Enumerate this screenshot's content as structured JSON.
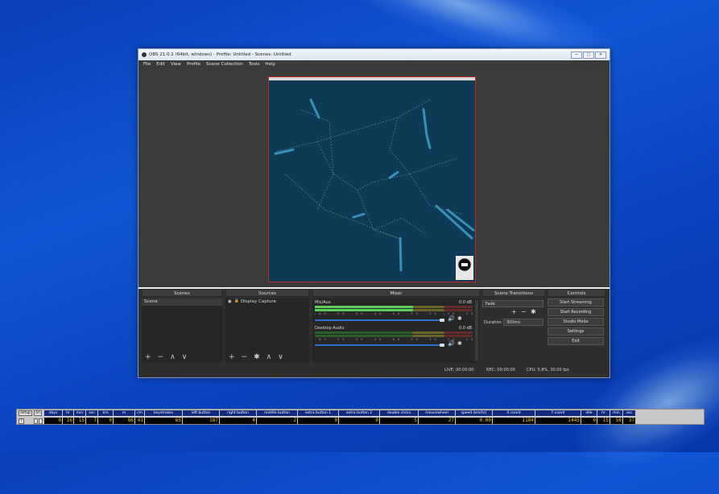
{
  "window": {
    "title": "OBS 21.0.1 (64bit, windows) - Profile: Untitled - Scenes: Untitled",
    "controls": [
      "—",
      "□",
      "✕"
    ]
  },
  "menu": [
    "File",
    "Edit",
    "View",
    "Profile",
    "Scene Collection",
    "Tools",
    "Help"
  ],
  "docks": {
    "scenes": {
      "header": "Scenes",
      "items": [
        "Scene"
      ]
    },
    "sources": {
      "header": "Sources",
      "items": [
        "Display Capture"
      ]
    },
    "mixer": {
      "header": "Mixer",
      "channels": [
        {
          "name": "Mic/Aux",
          "db": "0.0 dB",
          "level": 0.62
        },
        {
          "name": "Desktop Audio",
          "db": "0.0 dB",
          "level": 0.0
        }
      ],
      "scale": "-60 -55 -50 -45 -40 -35 -30 -25 -20 -15 -10 -5 0"
    },
    "transitions": {
      "header": "Scene Transitions",
      "selected": "Fade",
      "duration_label": "Duration",
      "duration_value": "300ms"
    },
    "controls": {
      "header": "Controls",
      "buttons": [
        "Start Streaming",
        "Start Recording",
        "Studio Mode",
        "Settings",
        "Exit"
      ]
    }
  },
  "status": {
    "live": "LIVE: 00:00:00",
    "rec": "REC: 00:00:00",
    "cpu": "CPU: 5.8%, 30.00 fps"
  },
  "icons": {
    "add": "+",
    "remove": "−",
    "up": "∧",
    "down": "∨",
    "gear": "✱",
    "eye": "◉",
    "lock": "🔒",
    "speaker": "🔊"
  },
  "stats": {
    "setup_label": "setup",
    "on_label": "on",
    "help_label": "?",
    "columns": [
      {
        "head": "days",
        "value": "0"
      },
      {
        "head": "hr",
        "value": "16"
      },
      {
        "head": "min",
        "value": "15"
      },
      {
        "head": "sec",
        "value": "7"
      },
      {
        "head": "km",
        "value": "0"
      },
      {
        "head": "m",
        "value": "86"
      },
      {
        "head": "cm",
        "value": "41"
      },
      {
        "head": "keystrokes",
        "value": "65"
      },
      {
        "head": "left button",
        "value": "187"
      },
      {
        "head": "right button",
        "value": "4"
      },
      {
        "head": "middle button",
        "value": "2"
      },
      {
        "head": "extra button 1",
        "value": "0"
      },
      {
        "head": "extra button 2",
        "value": "0"
      },
      {
        "head": "double clicks",
        "value": "5"
      },
      {
        "head": "mousewheel",
        "value": "27"
      },
      {
        "head": "speed (km/hr)",
        "value": "0.00"
      },
      {
        "head": "X coord",
        "value": "1184"
      },
      {
        "head": "Y coord",
        "value": "1445"
      },
      {
        "head": "idle",
        "value": "0"
      },
      {
        "head": "hr",
        "value": "15"
      },
      {
        "head": "min",
        "value": "58"
      },
      {
        "head": "sec",
        "value": "37"
      }
    ]
  }
}
